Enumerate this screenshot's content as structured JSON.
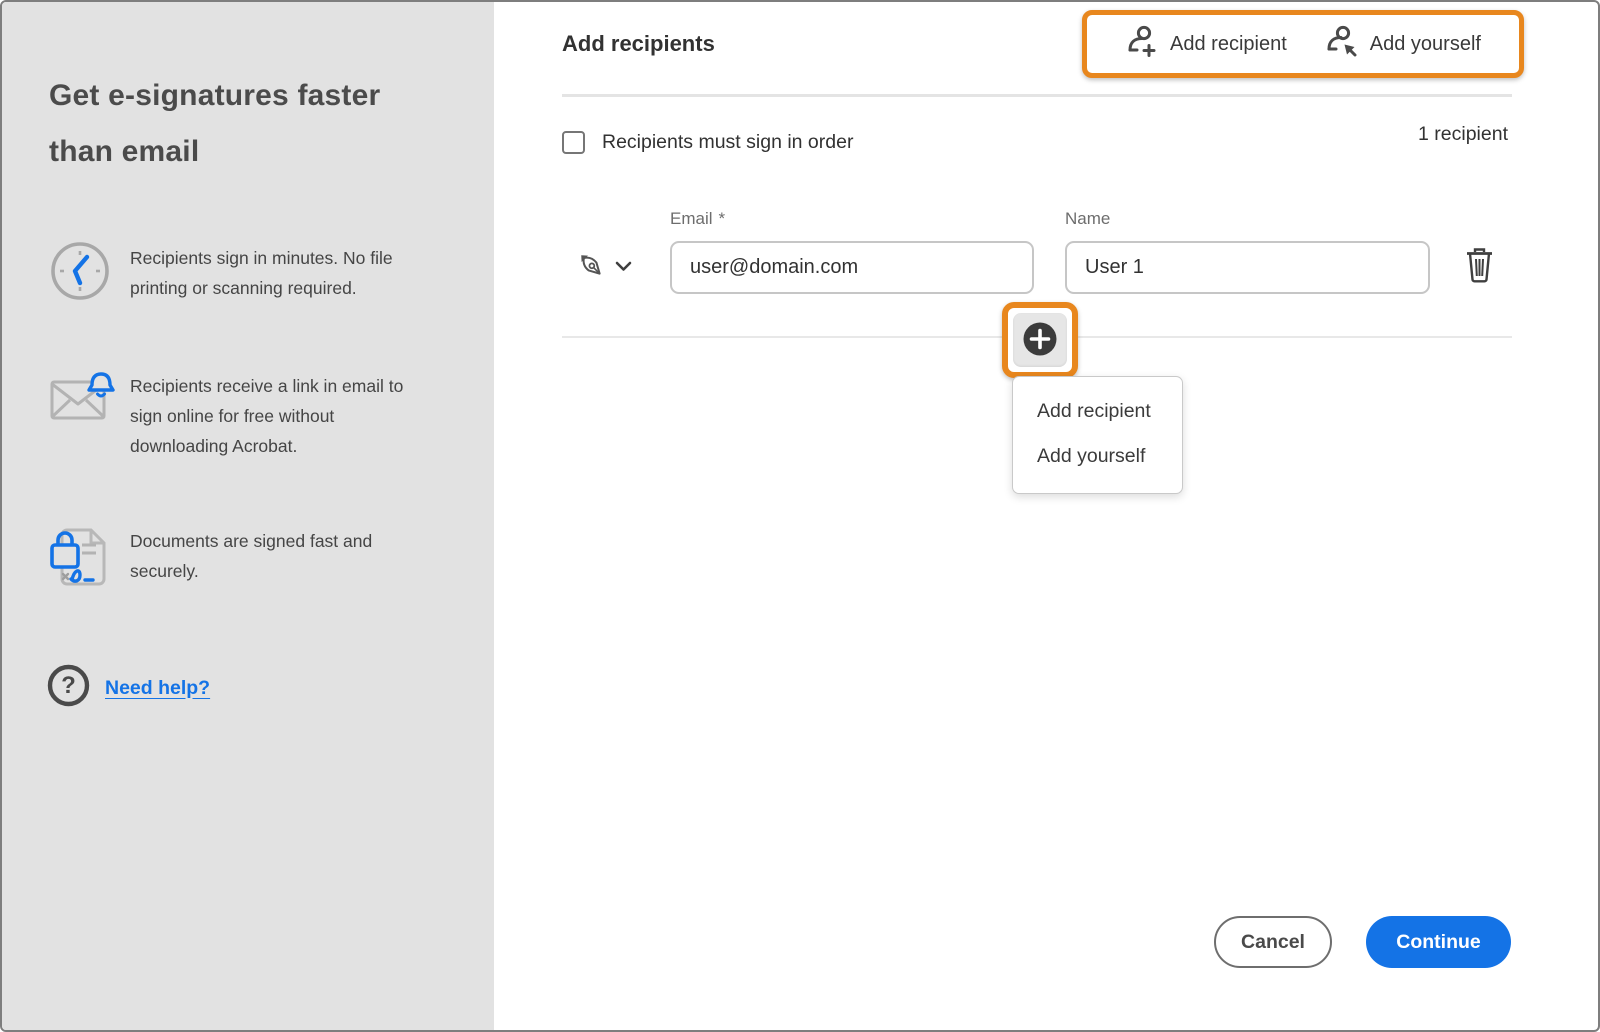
{
  "colors": {
    "accent_orange": "#E8871E",
    "primary_blue": "#1473E6",
    "link_blue": "#1473E6",
    "sidebar_bg": "#E2E2E2"
  },
  "sidebar": {
    "heading": "Get e-signatures faster than email",
    "features": [
      {
        "icon": "clock-icon",
        "text": "Recipients sign in minutes. No file printing or scanning required."
      },
      {
        "icon": "email-link-icon",
        "text": "Recipients receive a link in email to sign online for free without downloading Acrobat."
      },
      {
        "icon": "secure-document-icon",
        "text": "Documents are signed fast and securely."
      }
    ],
    "help_link_label": "Need help?"
  },
  "header": {
    "title": "Add recipients",
    "add_recipient_label": "Add recipient",
    "add_yourself_label": "Add yourself"
  },
  "recipients_panel": {
    "sign_in_order_label": "Recipients must sign in order",
    "count_label": "1 recipient",
    "email_label": "Email",
    "required_marker": "*",
    "name_label": "Name",
    "rows": [
      {
        "email": "user@domain.com",
        "name": "User 1"
      }
    ]
  },
  "add_menu": {
    "items": [
      "Add recipient",
      "Add yourself"
    ]
  },
  "footer": {
    "cancel_label": "Cancel",
    "continue_label": "Continue"
  }
}
